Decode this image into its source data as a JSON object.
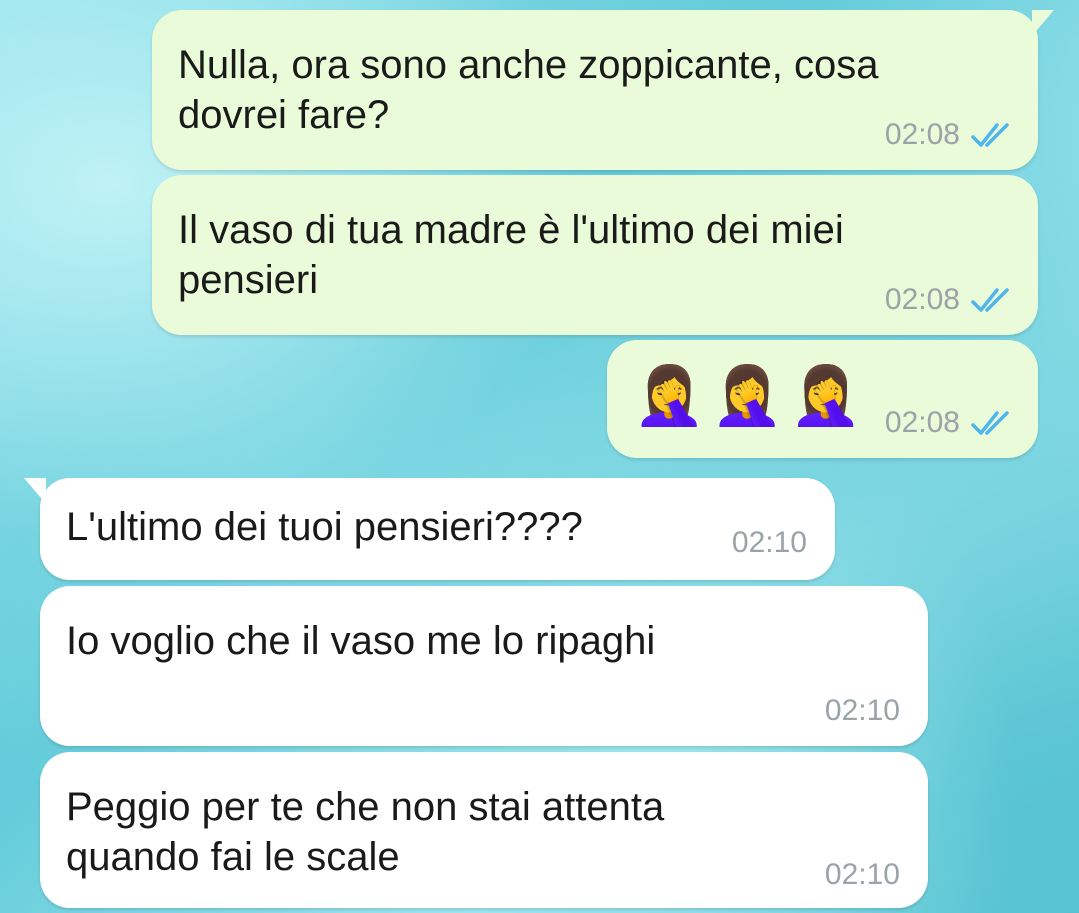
{
  "messages": [
    {
      "direction": "outgoing",
      "text": "Nulla, ora sono anche zoppicante, cosa\ndovrei fare?",
      "time": "02:08",
      "status": "read"
    },
    {
      "direction": "outgoing",
      "text": "Il vaso di tua madre è l'ultimo dei miei\npensieri",
      "time": "02:08",
      "status": "read"
    },
    {
      "direction": "outgoing",
      "emojis": [
        "🤦‍♀️",
        "🤦‍♀️",
        "🤦‍♀️"
      ],
      "time": "02:08",
      "status": "read"
    },
    {
      "direction": "incoming",
      "text": "L'ultimo dei tuoi pensieri????",
      "time": "02:10"
    },
    {
      "direction": "incoming",
      "text": "Io voglio che il vaso me lo ripaghi",
      "time": "02:10"
    },
    {
      "direction": "incoming",
      "text": "Peggio per te che non stai attenta\nquando fai le scale",
      "time": "02:10"
    }
  ],
  "colors": {
    "outgoing_bubble": "#e9fbd9",
    "incoming_bubble": "#ffffff",
    "read_ticks": "#4fb6ec",
    "time_text": "#9aa3a8"
  },
  "icons": {
    "read_receipt": "double-check-icon",
    "emoji": "woman-facepalming"
  }
}
